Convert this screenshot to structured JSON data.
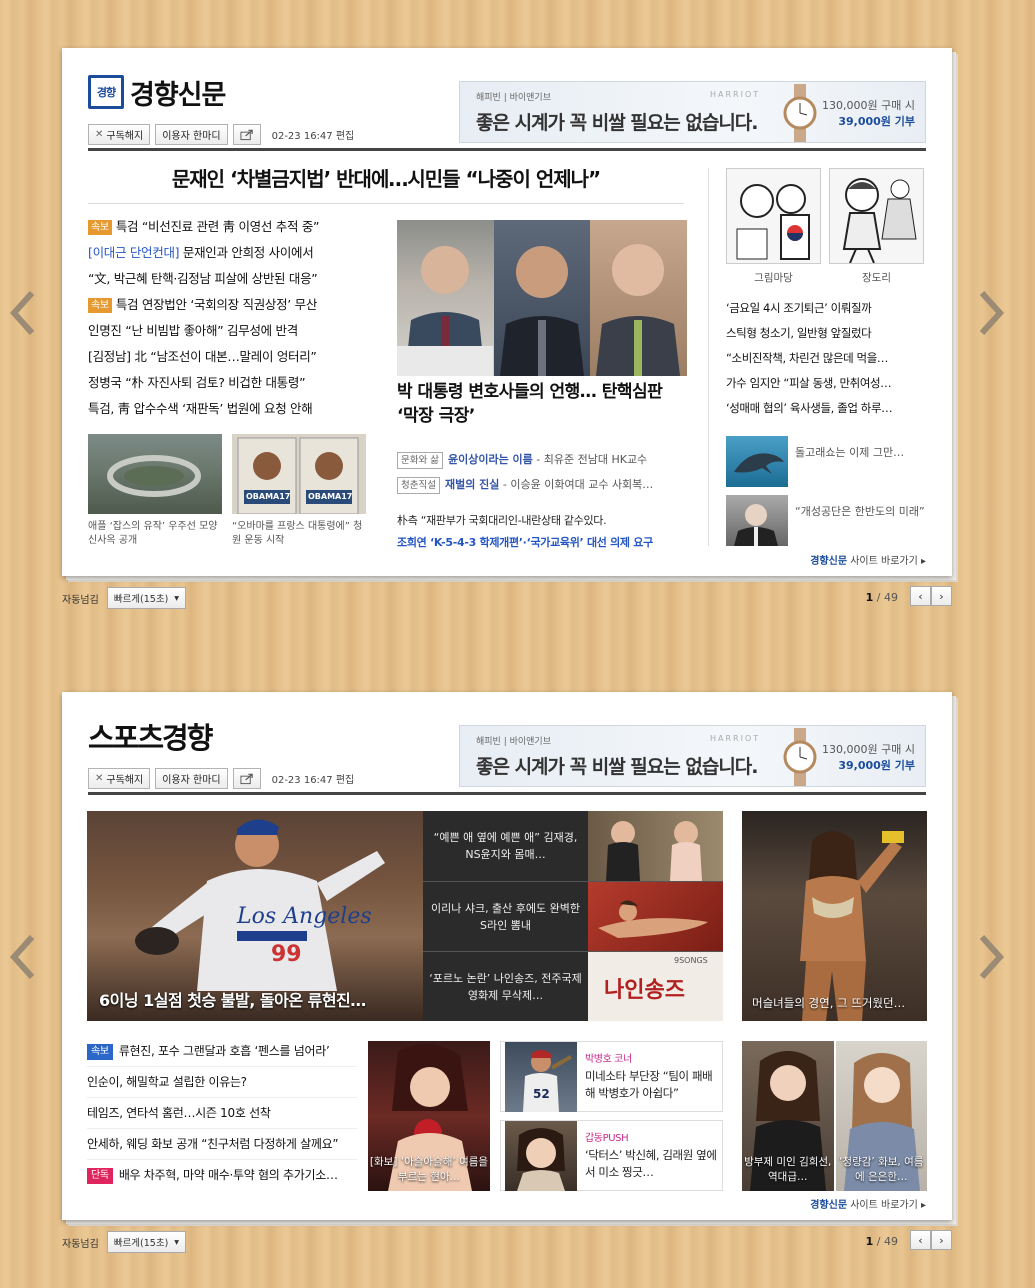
{
  "widgets": [
    {
      "logo_icon": "경향",
      "logo": "경향신문",
      "buttons": {
        "unsubscribe": "구독해지",
        "user_word": "이용자 한마디",
        "edit_time": "02-23 16:47 편집"
      },
      "ad": {
        "top": "해피빈 | 바이앤기브",
        "main": "좋은 시계가 꼭 비쌀 필요는 없습니다.",
        "brand": "HARRIOT",
        "price": "130,000원 구매 시",
        "donate": "39,000원 기부"
      },
      "headline": "문재인 ‘차별금지법’ 반대에…시민들 “나중이 언제나”",
      "news_list": [
        {
          "tag": "속보",
          "text": "특검 “비선진료 관련 靑 이영선 추적 중”"
        },
        {
          "prefix": "[이대근 단언컨대]",
          "text": " 문재인과 안희정 사이에서"
        },
        {
          "text": "“文, 박근혜 탄핵·김정남 피살에 상반된 대응”"
        },
        {
          "tag": "속보",
          "text": "특검 연장법안 ‘국회의장 직권상정’ 무산"
        },
        {
          "text": "인명진 “난 비빔밥 좋아해” 김무성에 반격"
        },
        {
          "text": "[김정남] 北 “남조선이 대본…말레이 엉터리”"
        },
        {
          "text": "정병국 “朴 자진사퇴 검토? 비겁한 대통령”",
          "blue": true
        },
        {
          "text": "특검, 靑 압수수색 ‘재판독’ 법원에 요청 안해"
        }
      ],
      "thumbs": [
        {
          "caption": "애플 ‘잡스의 유작’ 우주선 모양 신사옥 공개"
        },
        {
          "caption": "“오바마를 프랑스 대통령에” 청원 운동 시작",
          "poster": "OBAMA17"
        }
      ],
      "main_photo_title": "박 대통령 변호사들의 언행… 탄핵심판 ‘막장 극장’",
      "sub_list": [
        {
          "tag": "문화와 삶",
          "title": "윤이상이라는 이름",
          "by": " - 최유준 전남대 HK교수"
        },
        {
          "tag": "청춘직설",
          "title": "재벌의 진실",
          "by": " - 이승윤 이화여대 교수 사회복…"
        }
      ],
      "extra_list": [
        {
          "text": "朴측 “재판부가 국회대리인-내란상태 같수있다."
        },
        {
          "text": "조희연 ‘K-5-4-3 학제개편’·‘국가교육위’ 대선 의제 요구",
          "blue": true
        }
      ],
      "cartoons": [
        {
          "caption": "그림마당"
        },
        {
          "caption": "장도리"
        }
      ],
      "right_list": [
        "‘금요일 4시 조기퇴근’ 이뤄질까",
        "스틱형 청소기, 일반형 앞질렀다",
        "“소비진작책, 차린건 많은데 먹을…",
        "가수 임지안 “피살 동생, 만취여성…",
        "‘성매매 협의’ 육사생들, 졸업 하루…"
      ],
      "right_thumbs": [
        {
          "text": "돌고래쇼는 이제 그만…"
        },
        {
          "text": "“개성공단은 한반도의 미래”"
        }
      ],
      "shortcut_brand": "경향신문",
      "shortcut": " 사이트 바로가기 ▸",
      "pager": {
        "auto": "자동넘김",
        "speed": "빠르게(15초)",
        "current": "1",
        "total": " / 49"
      }
    },
    {
      "logo": "스포츠경향",
      "buttons": {
        "unsubscribe": "구독해지",
        "user_word": "이용자 한마디",
        "edit_time": "02-23 16:47 편집"
      },
      "ad": {
        "top": "해피빈 | 바이앤기브",
        "main": "좋은 시계가 꼭 비쌀 필요는 없습니다.",
        "brand": "HARRIOT",
        "price": "130,000원 구매 시",
        "donate": "39,000원 기부"
      },
      "hero_caption": "6이닝 1실점 첫승 불발, 돌아온 류현진…",
      "stack": [
        {
          "text": "“예쁜 애 옆에 예쁜 애” 김재경, NS윤지와 몸매…"
        },
        {
          "text": "이리나 샤크, 출산 후에도 완벽한 S라인 뽐내"
        },
        {
          "text": "‘포르노 논란’ 나인송즈, 전주국제영화제 무삭제…",
          "poster": "나인송즈",
          "poster_small": "9SONGS"
        }
      ],
      "big_right_caption": "머슬녀들의 경연, 그 뜨거웠던…",
      "list": [
        {
          "tag": "속보",
          "tagtype": "blue",
          "text": "류현진, 포수 그랜달과 호흡 ‘펜스를 넘어라’"
        },
        {
          "text": "인순이, 해밀학교 설립한 이유는?"
        },
        {
          "text": "테임즈, 연타석 홈런…시즌 10호 선착"
        },
        {
          "text": "안세하, 웨딩 화보 공개 “친구처럼 다정하게 살께요”"
        },
        {
          "tag": "단독",
          "tagtype": "red",
          "text": "배우 차주혁, 마약 매수·투약 혐의 추가기소…"
        }
      ],
      "photo_caption": "[화보] ‘아슬아슬해’ 여름을 부르는 현아…",
      "boxes": [
        {
          "label": "박병호 코너",
          "text": "미네소타 부단장 “팀이 패배해 박병호가 아쉽다”"
        },
        {
          "label": "갑동PUSH",
          "text": "‘닥터스’ 박신혜, 김래원 옆에서 미소 찡긋…"
        }
      ],
      "duo": [
        {
          "caption": "방부제 미인 김희선, 역대급…"
        },
        {
          "caption": "‘청량감’ 화보, 여름에 은은한…"
        }
      ],
      "shortcut_brand": "경향신문",
      "shortcut": " 사이트 바로가기 ▸",
      "pager": {
        "auto": "자동넘김",
        "speed": "빠르게(15초)",
        "current": "1",
        "total": " / 49"
      }
    }
  ],
  "colors": {
    "brand_blue": "#1b4c9c",
    "tag_orange": "#e6992f",
    "tag_red": "#e0245e",
    "tag_blue": "#2a67c9"
  },
  "icons": [
    "close-icon",
    "share-icon",
    "chevron-left-icon",
    "chevron-right-icon",
    "dropdown-icon"
  ]
}
